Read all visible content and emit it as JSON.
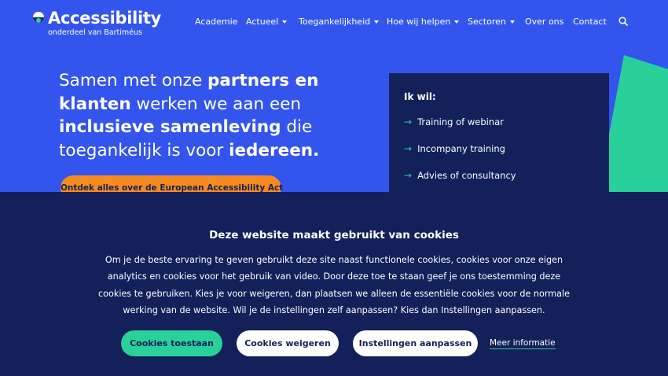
{
  "brand": {
    "title": "Accessibility",
    "subtitle": "onderdeel van Bartiméus",
    "accent_color": "#2ad09a",
    "primary_color": "#3355ee",
    "dark_color": "#13205a",
    "cta_color": "#f78a1e"
  },
  "nav": {
    "items": [
      {
        "label": "Academie"
      },
      {
        "label": "Actueel"
      },
      {
        "label": "Toegankelijkheid"
      },
      {
        "label": "Hoe wij helpen"
      },
      {
        "label": "Sectoren"
      },
      {
        "label": "Over ons"
      },
      {
        "label": "Contact"
      }
    ],
    "search_icon": "search-icon"
  },
  "hero": {
    "p1": "Samen met onze ",
    "b1": "partners en klanten",
    "p2": " werken we aan een ",
    "b2": "inclusieve samenleving",
    "p3": " die toegankelijk is voor ",
    "b3": "iedereen.",
    "cta_label": "Ontdek alles over de European Accessibility Act"
  },
  "card": {
    "title": "Ik wil:",
    "links": [
      {
        "label": "Training of webinar"
      },
      {
        "label": "Incompany training"
      },
      {
        "label": "Advies of consultancy"
      }
    ],
    "arrow_icon": "arrow-right-icon"
  },
  "cookie": {
    "title": "Deze website maakt gebruikt van cookies",
    "body": "Om je de beste ervaring te geven gebruikt deze site naast functionele cookies, cookies voor onze eigen analytics en cookies voor het gebruik van video. Door deze toe te staan geef je ons toestemming deze cookies te gebruiken. Kies je voor weigeren, dan plaatsen we alleen de essentiële cookies voor de normale werking van de website. Wil je de instellingen zelf aanpassen? Kies dan Instellingen aanpassen.",
    "accept_label": "Cookies toestaan",
    "refuse_label": "Cookies weigeren",
    "settings_label": "Instellingen aanpassen",
    "more_label": "Meer informatie"
  }
}
